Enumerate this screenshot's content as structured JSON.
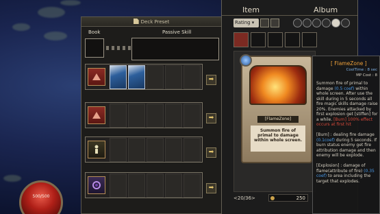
{
  "deck": {
    "title": "Deck Preset",
    "col_book": "Book",
    "col_passive": "Passive Skill"
  },
  "item_panel": {
    "tab_item": "Item",
    "tab_album": "Album",
    "sort_label": "Rating",
    "page_indicator": "<20/36>",
    "gold": "250"
  },
  "card": {
    "name": "[FlameZone]",
    "description": "Summon fire of primal to damage within whole screen."
  },
  "detail": {
    "title": "[ FlameZone ]",
    "cool_time": "CoolTime : 8 sec",
    "mp_cost": "MP Cost : 8",
    "body_1": "Summon fire of primal to damage",
    "body_1_hl": "(0.5 coef)",
    "body_2": "within whole screen. After use the skill during in 5 seconds all fire magic skills damage raise 20%. Enemies attacked by first explosion get [stiffen] for a while.",
    "body_3": "[Burn] 100% effect occurs at first hit",
    "body_4": "[Burn] : dealing fire damage",
    "body_4_hl": "(0.1coef)",
    "body_5": "during 5 seconds. If burn status enemy get fire attribution damage and then enemy will be explode.",
    "body_6": "[Explosion] : damage of flame(attribute of fire)",
    "body_6_hl": "(0.35 coef)",
    "body_7": "to area including the target that explodes."
  },
  "hud": {
    "hp_text": "500/500"
  }
}
